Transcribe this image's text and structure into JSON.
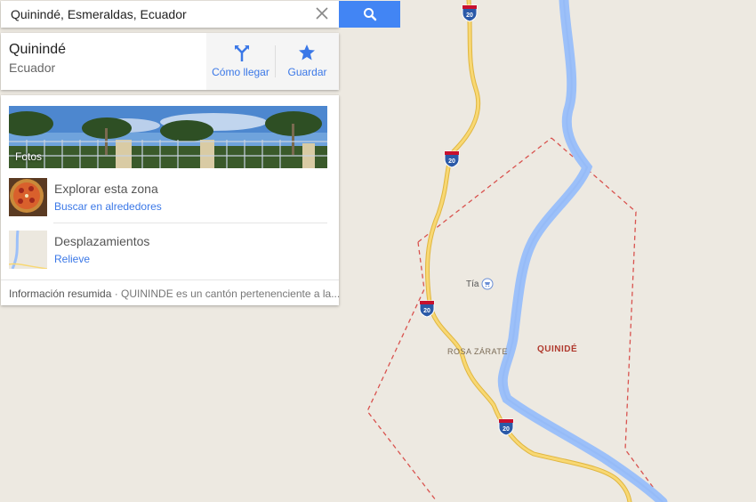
{
  "search": {
    "query": "Quinindé, Esmeraldas, Ecuador"
  },
  "place": {
    "name": "Quinindé",
    "country": "Ecuador"
  },
  "actions": {
    "directions": "Cómo llegar",
    "save": "Guardar"
  },
  "photos": {
    "label": "Fotos"
  },
  "explore": {
    "title": "Explorar esta zona",
    "link": "Buscar en alrededores"
  },
  "travel": {
    "title": "Desplazamientos",
    "link": "Relieve"
  },
  "summary": {
    "heading": "Información resumida",
    "text": " · QUININDE es un cantón pertenenciente a la..."
  },
  "map_labels": {
    "city": "QUINIDÉ",
    "neighborhood": "ROSA ZÁRATE",
    "poi": "Tía",
    "highway": "20"
  },
  "colors": {
    "accent": "#4285f4",
    "link": "#3b78e7",
    "road": "#f4cd5e",
    "river": "#9cc0f9",
    "boundary": "#d9534f",
    "land": "#ede9e1"
  }
}
